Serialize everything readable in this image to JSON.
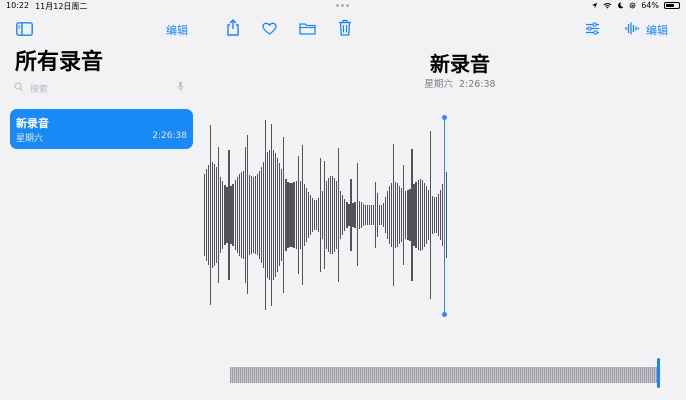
{
  "status_bar": {
    "time": "10:22",
    "date": "11月12日周二",
    "battery": "64%",
    "battery_level": 0.64
  },
  "toolbar": {
    "left_edit_label": "编辑",
    "right_edit_label": "编辑",
    "icons": [
      "sidebar-toggle-icon",
      "share-icon",
      "heart-icon",
      "folder-icon",
      "trash-icon",
      "sliders-icon",
      "waveform-icon"
    ]
  },
  "sidebar": {
    "title": "所有录音",
    "search_placeholder": "搜索",
    "recordings": [
      {
        "title": "新录音",
        "date": "星期六",
        "duration": "2:26:38",
        "selected": true
      }
    ]
  },
  "main": {
    "title": "新录音",
    "subtitle_day": "星期六",
    "subtitle_time": "2:26:38"
  },
  "colors": {
    "accent": "#1a84ff",
    "selected_row": "#1989f5",
    "background": "#f2f2f4",
    "waveform": "#525258"
  }
}
